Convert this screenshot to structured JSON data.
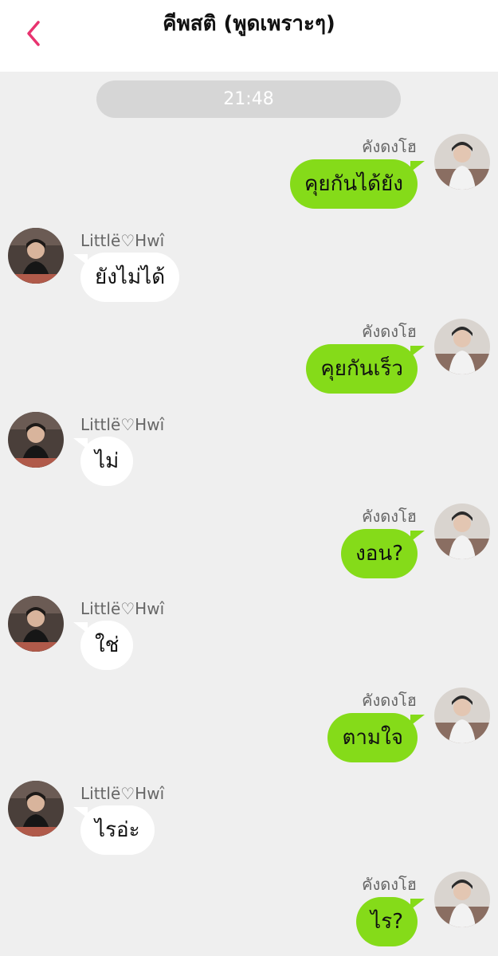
{
  "header": {
    "title": "คีพสติ (พูดเพราะๆ)"
  },
  "timestamp": "21:48",
  "accent_color": "#e8336f",
  "outgoing_bubble_color": "#85db19",
  "messages": [
    {
      "direction": "out",
      "sender": "คังดงโฮ",
      "text": "คุยกันได้ยัง"
    },
    {
      "direction": "in",
      "sender": "Littlë♡Hwî",
      "text": "ยังไม่ได้"
    },
    {
      "direction": "out",
      "sender": "คังดงโฮ",
      "text": "คุยกันเร็ว"
    },
    {
      "direction": "in",
      "sender": "Littlë♡Hwî",
      "text": "ไม่"
    },
    {
      "direction": "out",
      "sender": "คังดงโฮ",
      "text": "งอน?"
    },
    {
      "direction": "in",
      "sender": "Littlë♡Hwî",
      "text": "ใช่"
    },
    {
      "direction": "out",
      "sender": "คังดงโฮ",
      "text": "ตามใจ"
    },
    {
      "direction": "in",
      "sender": "Littlë♡Hwî",
      "text": "ไรอ่ะ"
    },
    {
      "direction": "out",
      "sender": "คังดงโฮ",
      "text": "ไร?"
    }
  ]
}
